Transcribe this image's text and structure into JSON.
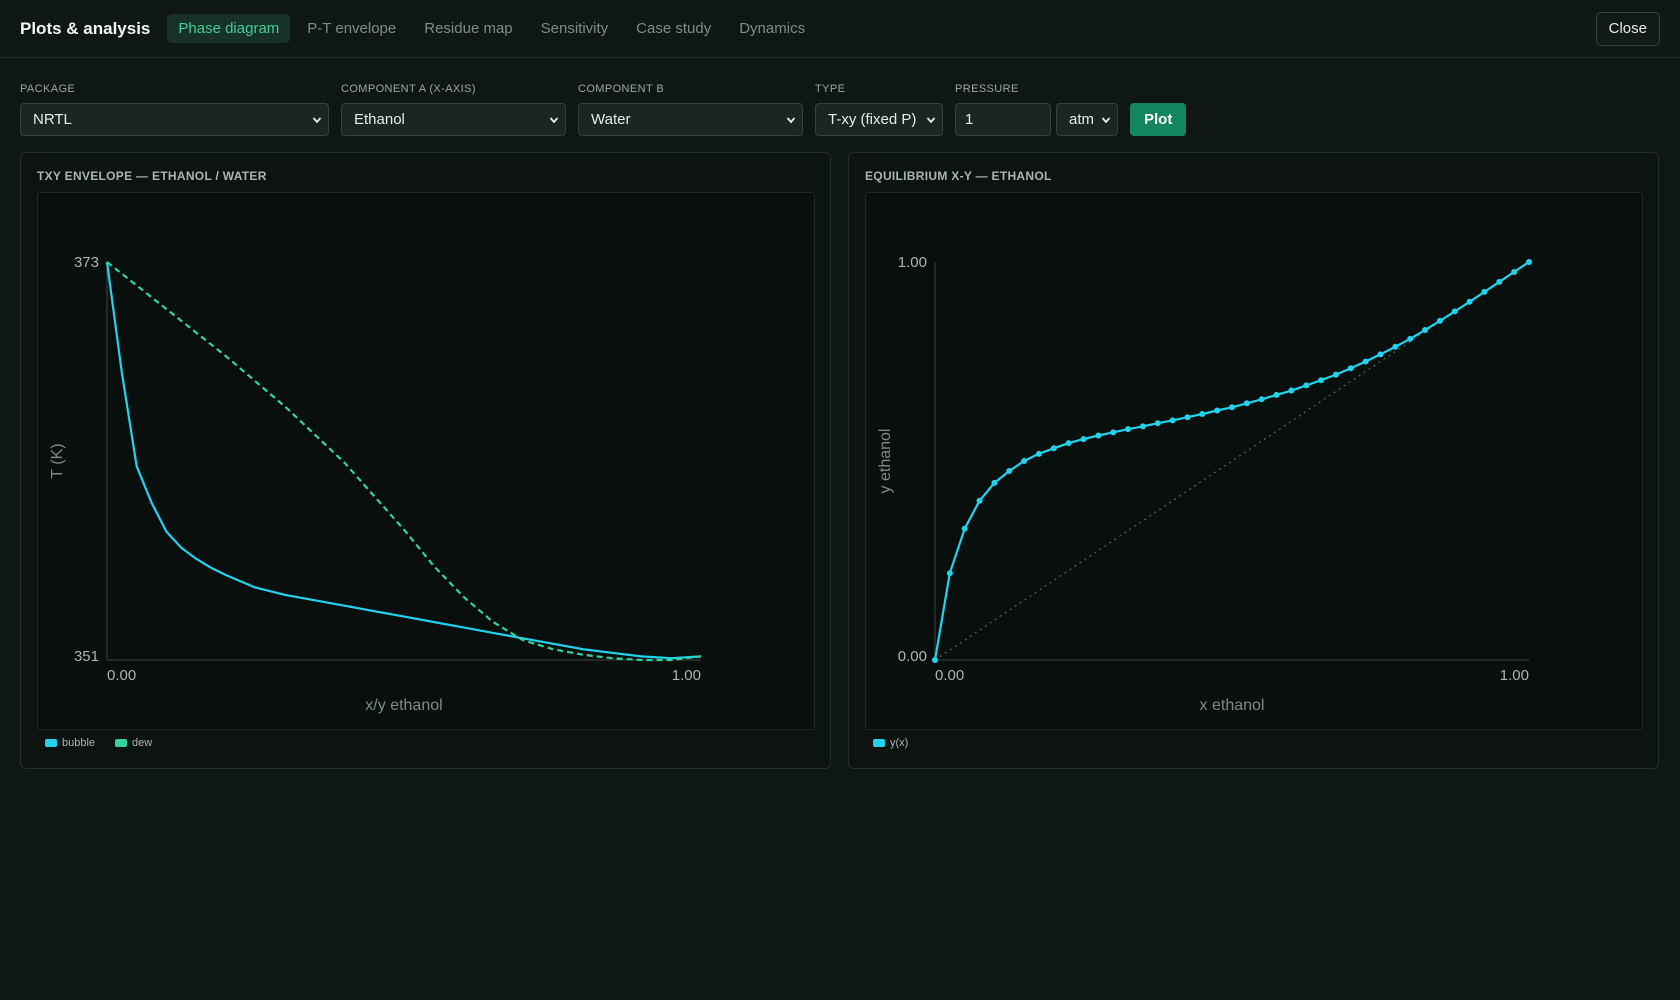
{
  "app": {
    "title": "Plots & analysis",
    "close_label": "Close"
  },
  "tabs": [
    {
      "label": "Phase diagram",
      "active": true
    },
    {
      "label": "P-T envelope",
      "active": false
    },
    {
      "label": "Residue map",
      "active": false
    },
    {
      "label": "Sensitivity",
      "active": false
    },
    {
      "label": "Case study",
      "active": false
    },
    {
      "label": "Dynamics",
      "active": false
    }
  ],
  "controls": {
    "package": {
      "label": "PACKAGE",
      "value": "NRTL"
    },
    "component_a": {
      "label": "COMPONENT A (X-AXIS)",
      "value": "Ethanol"
    },
    "component_b": {
      "label": "COMPONENT B",
      "value": "Water"
    },
    "type": {
      "label": "TYPE",
      "value": "T-xy (fixed P)"
    },
    "pressure": {
      "label": "PRESSURE",
      "value": "1",
      "unit": "atm"
    },
    "plot_label": "Plot"
  },
  "colors": {
    "accent": "#3ecf96",
    "bubble": "#22d3ee",
    "dew": "#34d399",
    "button": "#13855f"
  },
  "panels": {
    "txy": {
      "title": "TXY ENVELOPE — ETHANOL / WATER"
    },
    "xy": {
      "title": "EQUILIBRIUM X-Y — ETHANOL"
    }
  },
  "chart_data": [
    {
      "type": "line",
      "title": "TXY ENVELOPE — ETHANOL / WATER",
      "xlabel": "x/y ethanol",
      "ylabel": "T (K)",
      "xlim": [
        0,
        1
      ],
      "ylim": [
        351,
        373
      ],
      "x_tick_labels": [
        "0.00",
        "1.00"
      ],
      "y_tick_labels": [
        "351",
        "373"
      ],
      "legend": "bottom-left",
      "series": [
        {
          "name": "bubble",
          "style": "solid",
          "x": [
            0.0,
            0.025,
            0.05,
            0.075,
            0.1,
            0.125,
            0.15,
            0.175,
            0.2,
            0.25,
            0.3,
            0.35,
            0.4,
            0.45,
            0.5,
            0.55,
            0.6,
            0.65,
            0.7,
            0.75,
            0.8,
            0.85,
            0.9,
            0.95,
            1.0
          ],
          "y": [
            373.0,
            366.9,
            361.7,
            359.7,
            358.1,
            357.2,
            356.6,
            356.1,
            355.7,
            355.0,
            354.6,
            354.3,
            354.0,
            353.7,
            353.4,
            353.1,
            352.8,
            352.5,
            352.2,
            351.9,
            351.6,
            351.4,
            351.2,
            351.1,
            351.2
          ]
        },
        {
          "name": "dew",
          "style": "dashed",
          "x": [
            0.0,
            0.1,
            0.2,
            0.3,
            0.4,
            0.5,
            0.55,
            0.6,
            0.65,
            0.7,
            0.75,
            0.8,
            0.85,
            0.9,
            0.95,
            1.0
          ],
          "y": [
            373.0,
            370.4,
            367.8,
            365.0,
            361.9,
            358.2,
            356.2,
            354.5,
            353.1,
            352.1,
            351.6,
            351.3,
            351.1,
            351.0,
            351.0,
            351.2
          ]
        }
      ]
    },
    {
      "type": "line",
      "title": "EQUILIBRIUM X-Y — ETHANOL",
      "xlabel": "x ethanol",
      "ylabel": "y ethanol",
      "xlim": [
        0,
        1
      ],
      "ylim": [
        0,
        1
      ],
      "x_tick_labels": [
        "0.00",
        "1.00"
      ],
      "y_tick_labels": [
        "0.00",
        "1.00"
      ],
      "legend": "bottom-left",
      "diagonal": true,
      "series": [
        {
          "name": "y(x)",
          "style": "solid-markers",
          "x": [
            0.0,
            0.025,
            0.05,
            0.075,
            0.1,
            0.125,
            0.15,
            0.175,
            0.2,
            0.225,
            0.25,
            0.275,
            0.3,
            0.325,
            0.35,
            0.375,
            0.4,
            0.425,
            0.45,
            0.475,
            0.5,
            0.525,
            0.55,
            0.575,
            0.6,
            0.625,
            0.65,
            0.675,
            0.7,
            0.725,
            0.75,
            0.775,
            0.8,
            0.825,
            0.85,
            0.875,
            0.9,
            0.925,
            0.95,
            0.975,
            1.0
          ],
          "y": [
            0.0,
            0.218,
            0.33,
            0.4,
            0.445,
            0.475,
            0.5,
            0.518,
            0.532,
            0.545,
            0.555,
            0.564,
            0.572,
            0.58,
            0.587,
            0.595,
            0.602,
            0.61,
            0.618,
            0.627,
            0.635,
            0.645,
            0.655,
            0.666,
            0.677,
            0.69,
            0.703,
            0.717,
            0.733,
            0.75,
            0.768,
            0.787,
            0.807,
            0.829,
            0.852,
            0.876,
            0.9,
            0.925,
            0.95,
            0.975,
            1.0
          ]
        }
      ]
    }
  ]
}
